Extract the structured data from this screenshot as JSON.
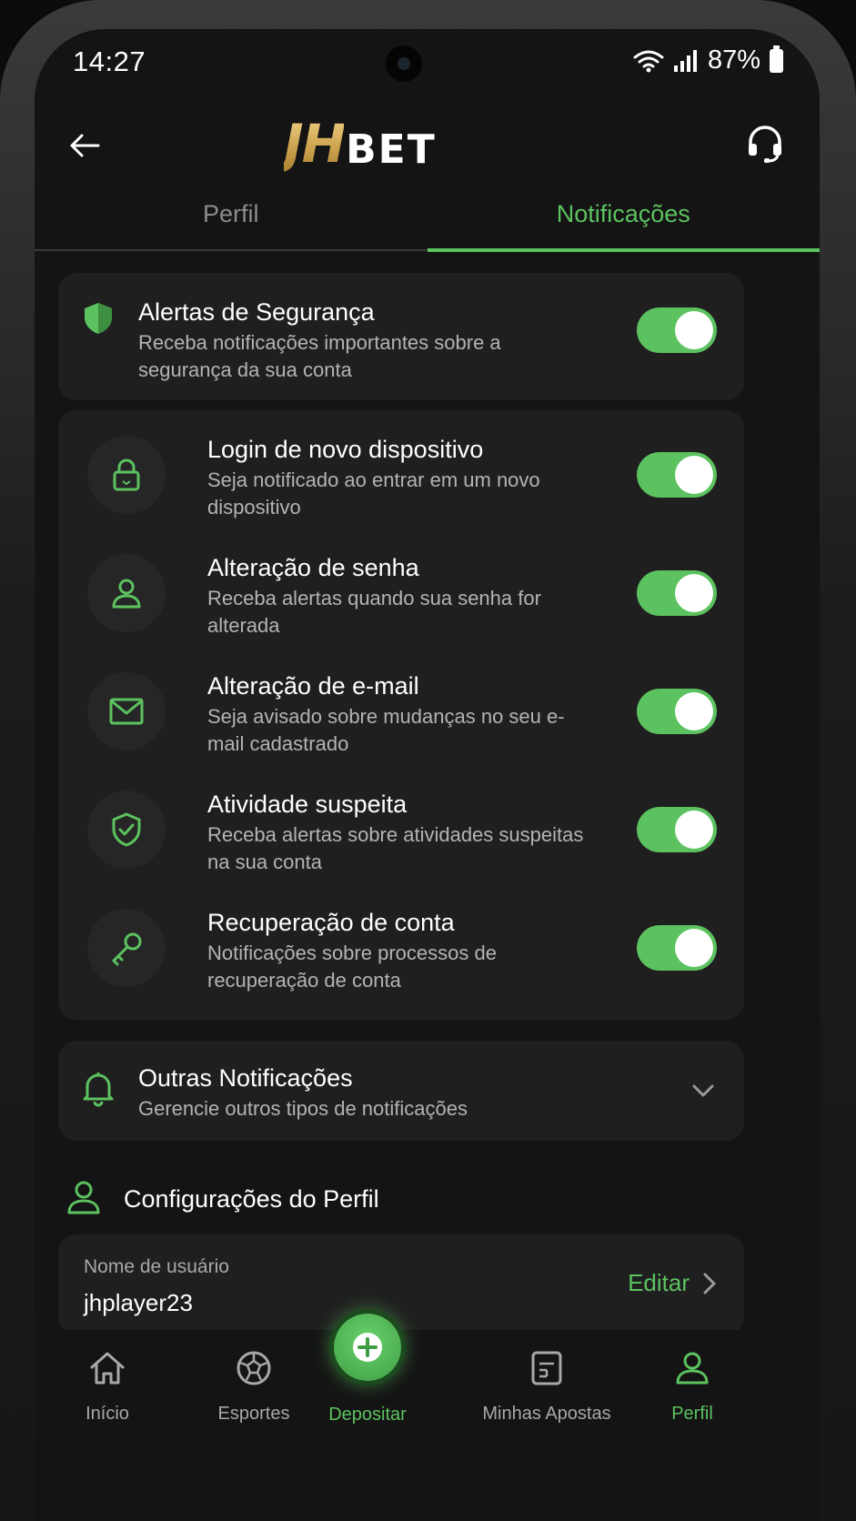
{
  "status_bar": {
    "time": "14:27",
    "battery": "87%"
  },
  "header": {
    "logo_jh": "JH",
    "logo_bet": "BET"
  },
  "tabs": [
    {
      "label": "Perfil",
      "active": false
    },
    {
      "label": "Notificações",
      "active": true
    }
  ],
  "security_alerts": {
    "title": "Alertas de Segurança",
    "description": "Receba notificações importantes sobre a segurança da sua conta",
    "enabled": true
  },
  "security_items": [
    {
      "icon": "lock-icon",
      "title": "Login de novo dispositivo",
      "description": "Seja notificado ao entrar em um novo dispositivo",
      "enabled": true
    },
    {
      "icon": "user-icon",
      "title": "Alteração de senha",
      "description": "Receba alertas quando sua senha for alterada",
      "enabled": true
    },
    {
      "icon": "mail-icon",
      "title": "Alteração de e-mail",
      "description": "Seja avisado sobre mudanças no seu e-mail cadastrado",
      "enabled": true
    },
    {
      "icon": "shield-check-icon",
      "title": "Atividade suspeita",
      "description": "Receba alertas sobre atividades suspeitas na sua conta",
      "enabled": true
    },
    {
      "icon": "key-icon",
      "title": "Recuperação de conta",
      "description": "Notificações sobre processos de recuperação de conta",
      "enabled": true
    }
  ],
  "other_notifications": {
    "title": "Outras Notificações",
    "description": "Gerencie outros tipos de notificações"
  },
  "profile_settings": {
    "title": "Configurações do Perfil",
    "username_label": "Nome de usuário",
    "username_value": "jhplayer23",
    "edit_label": "Editar"
  },
  "bottom_nav": [
    {
      "label": "Início",
      "icon": "home-icon",
      "active": false
    },
    {
      "label": "Esportes",
      "icon": "soccer-ball-icon",
      "active": false
    },
    {
      "label": "Depositar",
      "icon": "plus-icon",
      "active": false
    },
    {
      "label": "Minhas Apostas",
      "icon": "bet-slip-icon",
      "active": false
    },
    {
      "label": "Perfil",
      "icon": "profile-icon",
      "active": true
    }
  ],
  "colors": {
    "accent": "#5cc25f",
    "background": "#141414",
    "card": "#1f1f1f",
    "gold": "#c9a04b"
  }
}
